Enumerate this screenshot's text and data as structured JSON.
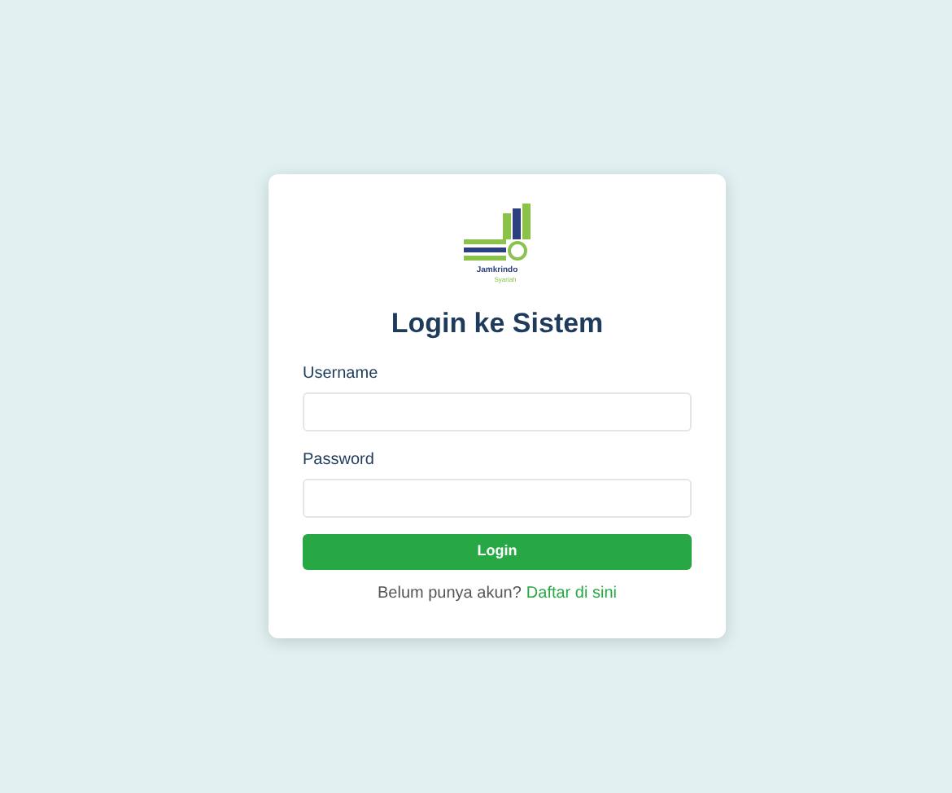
{
  "logo": {
    "name": "Jamkrindo",
    "tagline": "Syariah"
  },
  "title": "Login ke Sistem",
  "fields": [
    {
      "label": "Username"
    },
    {
      "label": "Password"
    }
  ],
  "button": "Login",
  "footer": {
    "text": "Belum punya akun?",
    "link": "Daftar di sini"
  }
}
